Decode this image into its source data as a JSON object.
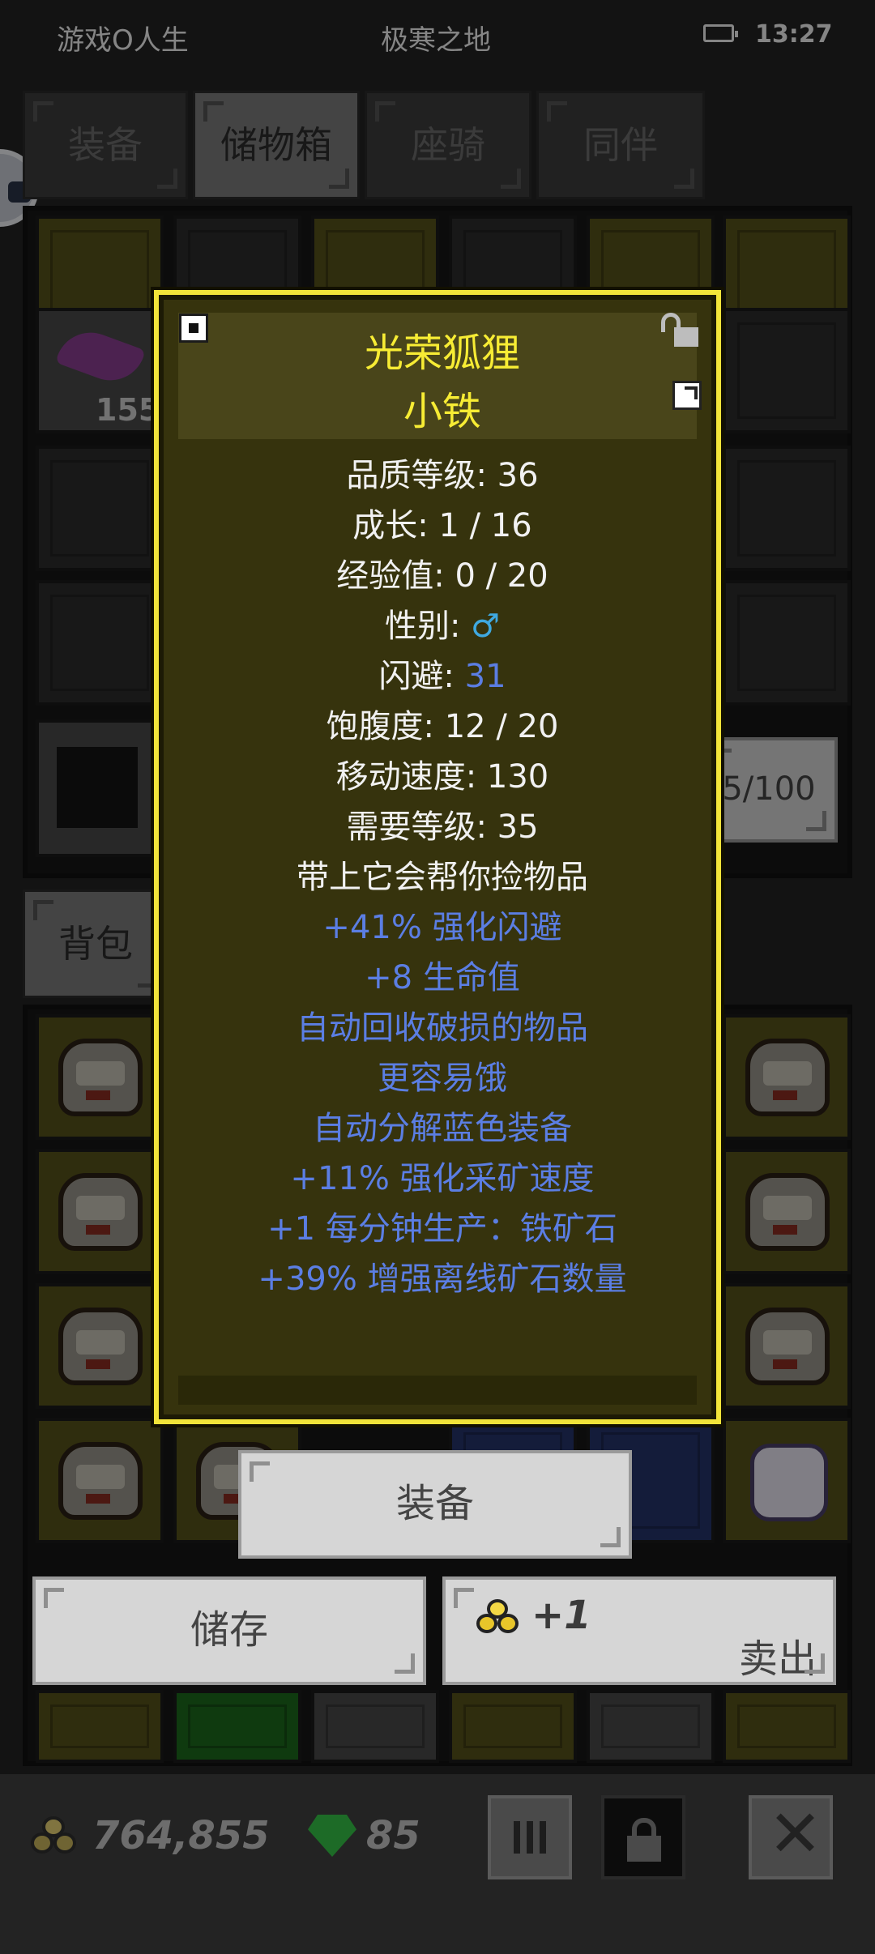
{
  "status_bar": {
    "app_name": "游戏O人生",
    "location": "极寒之地",
    "time": "13:27"
  },
  "tabs": [
    {
      "label": "装备",
      "active": false
    },
    {
      "label": "储物箱",
      "active": true
    },
    {
      "label": "座骑",
      "active": false
    },
    {
      "label": "同伴",
      "active": false
    }
  ],
  "storage": {
    "stack_count": "155",
    "capacity": "5/100"
  },
  "backpack_tab": "背包",
  "tooltip": {
    "name": "光荣狐狸",
    "nickname": "小铁",
    "stats": [
      "品质等级: 36",
      "成长: 1 / 16",
      "经验值: 0 / 20"
    ],
    "gender_label": "性别: ",
    "gender_symbol": "♂",
    "dodge_label": "闪避: ",
    "dodge_value": "31",
    "stats2": [
      "饱腹度: 12 / 20",
      "移动速度: 130",
      "需要等级: 35",
      "带上它会帮你捡物品"
    ],
    "effects": [
      "+41% 强化闪避",
      "+8 生命值",
      "自动回收破损的物品",
      "更容易饿",
      "自动分解蓝色装备",
      "+11% 强化采矿速度",
      "+1 每分钟生产：铁矿石",
      "+39% 增强离线矿石数量"
    ]
  },
  "actions": {
    "equip": "装备",
    "store": "储存",
    "sell_gain": "+1",
    "sell": "卖出"
  },
  "currency": {
    "gold": "764,855",
    "gems": "85"
  },
  "colors": {
    "tooltip_border": "#f2e43a",
    "title": "#f7ec34",
    "effect_text": "#5b7ee3"
  }
}
